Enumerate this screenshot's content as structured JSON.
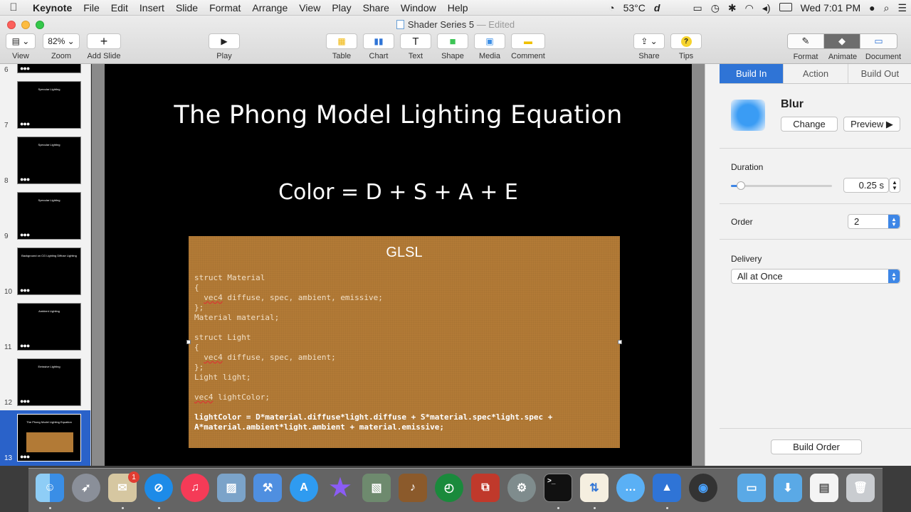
{
  "menubar": {
    "apple": "",
    "items": [
      "Keynote",
      "File",
      "Edit",
      "Insert",
      "Slide",
      "Format",
      "Arrange",
      "View",
      "Play",
      "Share",
      "Window",
      "Help"
    ],
    "temperature": "53°C",
    "clock": "Wed 7:01 PM"
  },
  "window": {
    "doc_name": "Shader Series 5",
    "doc_state": "— Edited"
  },
  "toolbar": {
    "view": "View",
    "zoom_value": "82%",
    "zoom": "Zoom",
    "add_slide": "Add Slide",
    "play": "Play",
    "table": "Table",
    "chart": "Chart",
    "text": "Text",
    "shape": "Shape",
    "media": "Media",
    "comment": "Comment",
    "share": "Share",
    "tips": "Tips",
    "format": "Format",
    "animate": "Animate",
    "document": "Document"
  },
  "navigator": {
    "slides": [
      {
        "num": "6",
        "title": ""
      },
      {
        "num": "7",
        "title": "Specular Lighting"
      },
      {
        "num": "8",
        "title": "Specular Lighting"
      },
      {
        "num": "9",
        "title": "Specular Lighting"
      },
      {
        "num": "10",
        "title": "Background on CG Lighting Diffuse Lighting"
      },
      {
        "num": "11",
        "title": "Ambient Lighting"
      },
      {
        "num": "12",
        "title": "Emissive Lighting"
      },
      {
        "num": "13",
        "title": "The Phong Model Lighting Equation"
      }
    ],
    "dots": "●●●",
    "selected": "13"
  },
  "slide": {
    "title": "The Phong Model Lighting Equation",
    "equation": "Color = D + S + A + E",
    "box_title": "GLSL",
    "code": {
      "l1": "struct Material",
      "l2": "{",
      "l3_kw": "vec4",
      "l3_rest": " diffuse, spec, ambient, emissive;",
      "l4": "};",
      "l5": "Material material;",
      "l6": "struct Light",
      "l7": "{",
      "l8_kw": "vec4",
      "l8_rest": " diffuse, spec, ambient;",
      "l9": "};",
      "l10": "Light light;",
      "l11_kw": "vec4",
      "l11_rest": " lightColor;",
      "l12": "lightColor = D*material.diffuse*light.diffuse + S*material.spec*light.spec +",
      "l13": "A*material.ambient*light.ambient + material.emissive;"
    }
  },
  "inspector": {
    "tabs": [
      "Build In",
      "Action",
      "Build Out"
    ],
    "active_tab": "Build In",
    "effect": "Blur",
    "change": "Change",
    "preview": "Preview ▶",
    "duration_label": "Duration",
    "duration_value": "0.25 s",
    "duration_level": 0.1,
    "order_label": "Order",
    "order_value": "2",
    "delivery_label": "Delivery",
    "delivery_value": "All at Once",
    "build_order": "Build Order"
  },
  "dock": {
    "mail_badge": "1"
  },
  "colors": {
    "accent": "#2f74d6",
    "code_box": "#b27a36",
    "selection": "#2a62c9"
  }
}
